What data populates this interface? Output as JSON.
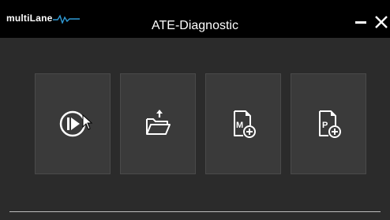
{
  "app": {
    "logo_text": "multiLane",
    "title": "ATE-Diagnostic"
  },
  "titlebar": {
    "minimize_icon": "minimize-icon",
    "close_icon": "close-icon"
  },
  "actions": [
    {
      "icon": "run-icon"
    },
    {
      "icon": "open-folder-icon"
    },
    {
      "icon": "new-module-file-icon",
      "letter": "M"
    },
    {
      "icon": "new-project-file-icon",
      "letter": "P"
    }
  ],
  "colors": {
    "titlebar_bg": "#000000",
    "window_bg": "#2b2b2b",
    "tile_bg": "#3a3a3a",
    "icon_color": "#ffffff",
    "logo_wave": "#2f9bd6"
  }
}
